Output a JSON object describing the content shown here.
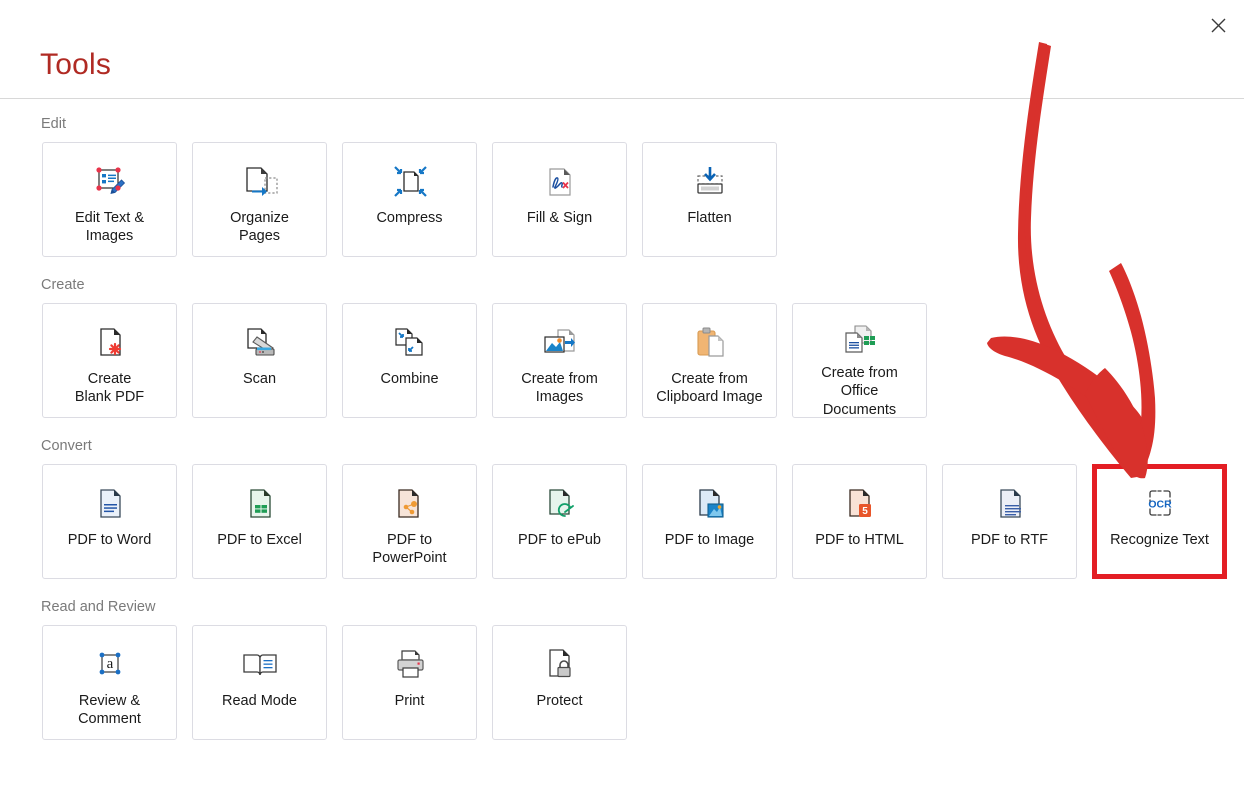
{
  "window": {
    "title": "Tools",
    "close_label": "✕",
    "close_icon": "close-icon",
    "title_color": "#b02a23"
  },
  "annotation": {
    "type": "hand-drawn-arrow",
    "color": "#d32f2f",
    "points_to": "Recognize Text",
    "highlight_color": "#e31e24"
  },
  "sections": [
    {
      "label": "Edit",
      "tiles": [
        {
          "label": "Edit Text &\nImages",
          "icon": "edit-text-images-icon"
        },
        {
          "label": "Organize\nPages",
          "icon": "organize-pages-icon"
        },
        {
          "label": "Compress",
          "icon": "compress-icon"
        },
        {
          "label": "Fill & Sign",
          "icon": "fill-sign-icon"
        },
        {
          "label": "Flatten",
          "icon": "flatten-icon"
        }
      ]
    },
    {
      "label": "Create",
      "tiles": [
        {
          "label": "Create\nBlank PDF",
          "icon": "create-blank-pdf-icon"
        },
        {
          "label": "Scan",
          "icon": "scan-icon"
        },
        {
          "label": "Combine",
          "icon": "combine-icon"
        },
        {
          "label": "Create from\nImages",
          "icon": "create-from-images-icon"
        },
        {
          "label": "Create from\nClipboard Image",
          "icon": "create-from-clipboard-icon"
        },
        {
          "label": "Create from\nOffice\nDocuments",
          "icon": "create-from-office-icon"
        }
      ]
    },
    {
      "label": "Convert",
      "tiles": [
        {
          "label": "PDF to Word",
          "icon": "pdf-to-word-icon"
        },
        {
          "label": "PDF to Excel",
          "icon": "pdf-to-excel-icon"
        },
        {
          "label": "PDF to\nPowerPoint",
          "icon": "pdf-to-powerpoint-icon"
        },
        {
          "label": "PDF to ePub",
          "icon": "pdf-to-epub-icon"
        },
        {
          "label": "PDF to Image",
          "icon": "pdf-to-image-icon"
        },
        {
          "label": "PDF to HTML",
          "icon": "pdf-to-html-icon"
        },
        {
          "label": "PDF to RTF",
          "icon": "pdf-to-rtf-icon"
        },
        {
          "label": "Recognize Text",
          "icon": "ocr-icon",
          "highlighted": true
        }
      ]
    },
    {
      "label": "Read and Review",
      "tiles": [
        {
          "label": "Review &\nComment",
          "icon": "review-comment-icon"
        },
        {
          "label": "Read Mode",
          "icon": "read-mode-icon"
        },
        {
          "label": "Print",
          "icon": "print-icon"
        },
        {
          "label": "Protect",
          "icon": "protect-icon"
        }
      ]
    }
  ]
}
